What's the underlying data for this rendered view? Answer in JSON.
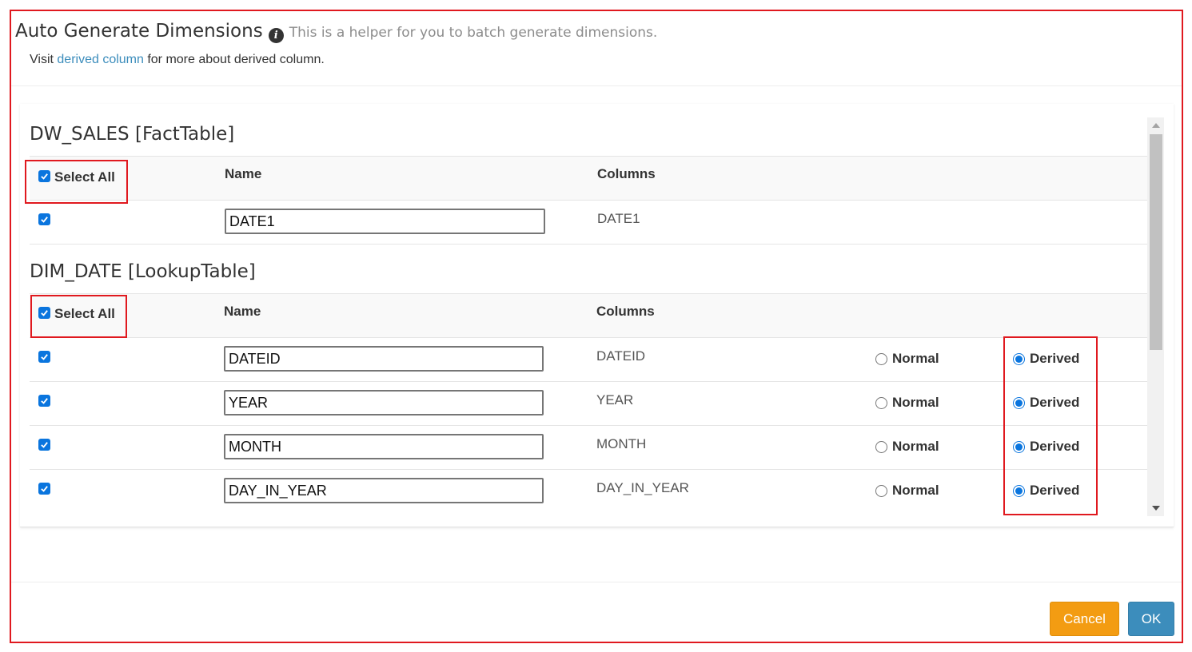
{
  "dialog": {
    "title": "Auto Generate Dimensions",
    "info_icon": "info-circle-icon",
    "helper_text": "This is a helper for you to batch generate dimensions.",
    "subtitle_prefix": "Visit ",
    "subtitle_link": "derived column",
    "subtitle_suffix": " for more about derived column."
  },
  "tables": [
    {
      "title": "DW_SALES [FactTable]",
      "select_all_label": "Select All",
      "select_all_checked": true,
      "headers": {
        "name": "Name",
        "columns": "Columns"
      },
      "rows": [
        {
          "checked": true,
          "name": "DATE1",
          "column": "DATE1"
        }
      ]
    },
    {
      "title": "DIM_DATE [LookupTable]",
      "select_all_label": "Select All",
      "select_all_checked": true,
      "headers": {
        "name": "Name",
        "columns": "Columns"
      },
      "rows": [
        {
          "checked": true,
          "name": "DATEID",
          "column": "DATEID",
          "normal_label": "Normal",
          "derived_label": "Derived",
          "selected": "Derived"
        },
        {
          "checked": true,
          "name": "YEAR",
          "column": "YEAR",
          "normal_label": "Normal",
          "derived_label": "Derived",
          "selected": "Derived"
        },
        {
          "checked": true,
          "name": "MONTH",
          "column": "MONTH",
          "normal_label": "Normal",
          "derived_label": "Derived",
          "selected": "Derived"
        },
        {
          "checked": true,
          "name": "DAY_IN_YEAR",
          "column": "DAY_IN_YEAR",
          "normal_label": "Normal",
          "derived_label": "Derived",
          "selected": "Derived"
        }
      ]
    }
  ],
  "footer": {
    "cancel_label": "Cancel",
    "ok_label": "OK"
  },
  "colors": {
    "highlight_border": "#e0191f",
    "link": "#3c8dbc",
    "cancel_button": "#f39c12",
    "ok_button": "#3c8dbc",
    "checkbox": "#0a75de"
  }
}
